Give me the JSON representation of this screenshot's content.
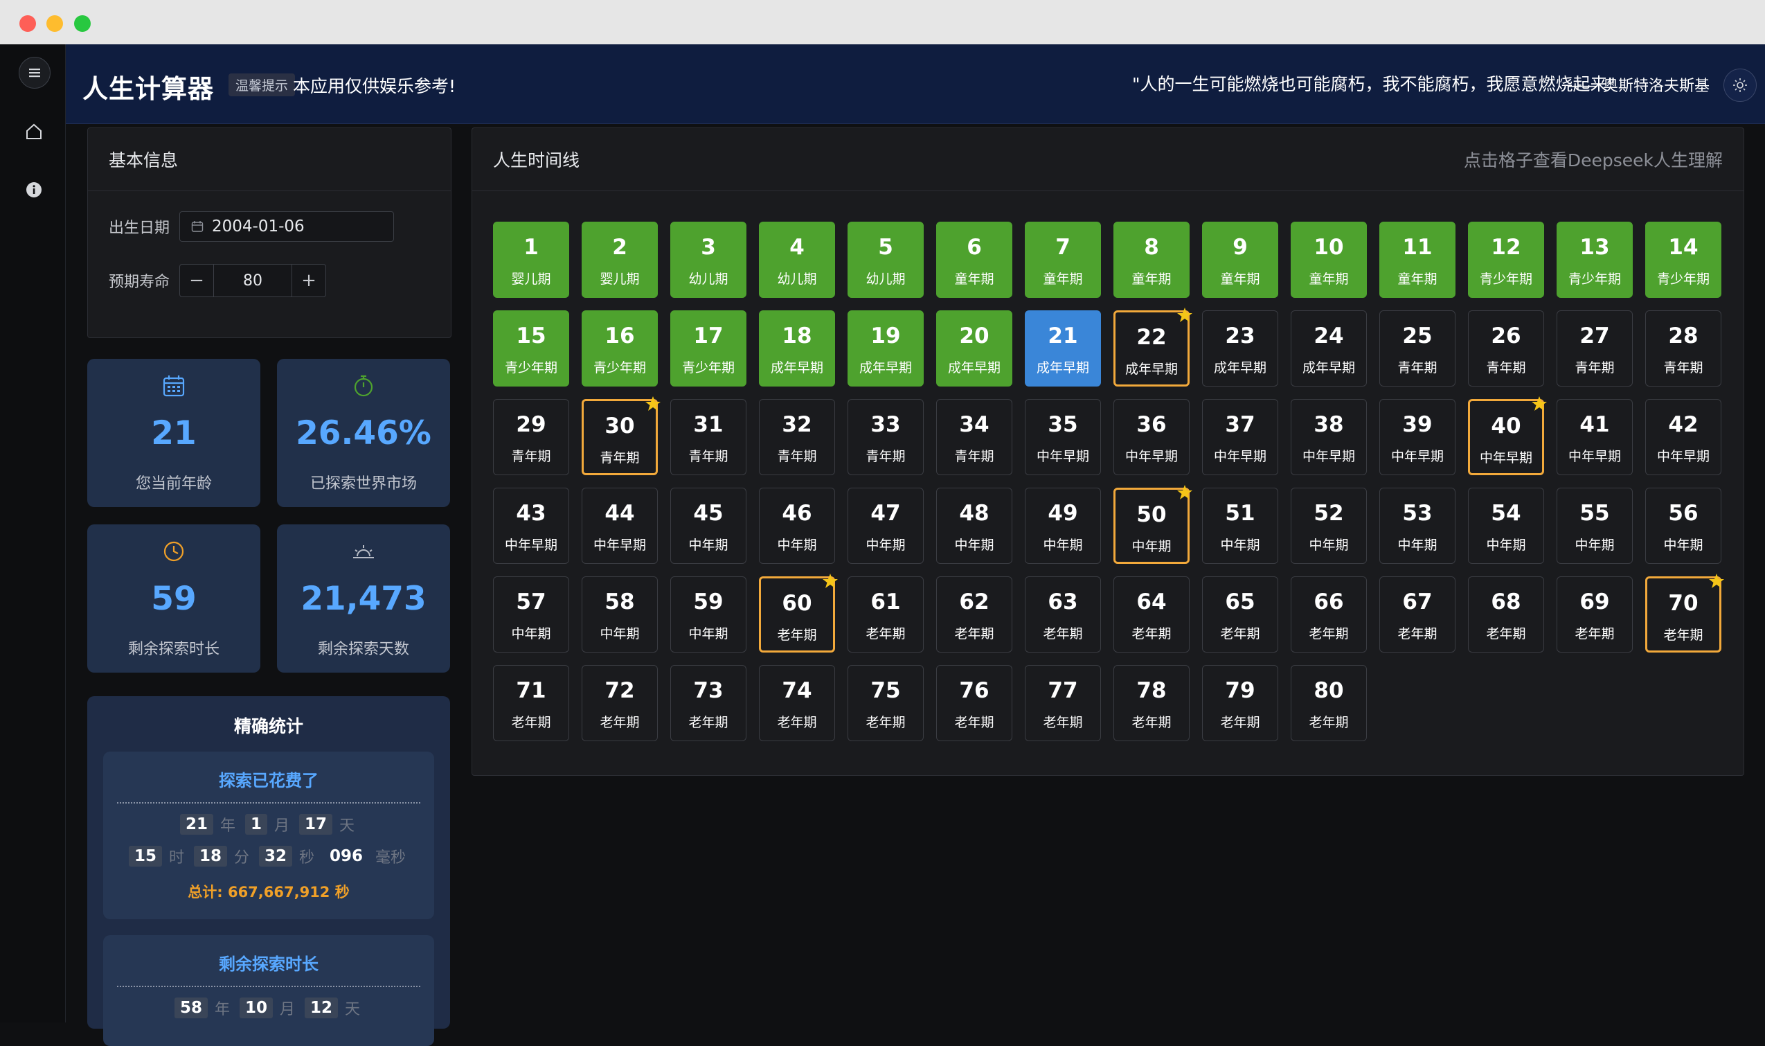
{
  "colors": {
    "past": "#4ea22e",
    "current": "#3a86d8",
    "milestone": "#f2a93b",
    "accent": "#58a8ff",
    "total": "#f0a028"
  },
  "header": {
    "title": "人生计算器",
    "tip_badge": "温馨提示",
    "tip_text": "本应用仅供娱乐参考!",
    "quote": "\"人的一生可能燃烧也可能腐朽，我不能腐朽，我愿意燃烧起来\"",
    "quote_author": "—— 奥斯特洛夫斯基"
  },
  "sidebar": {
    "items": [
      {
        "icon": "menu-icon"
      },
      {
        "icon": "home-icon"
      },
      {
        "icon": "info-icon"
      }
    ]
  },
  "basic_info": {
    "title": "基本信息",
    "birth_label": "出生日期",
    "birth_value": "2004-01-06",
    "life_label": "预期寿命",
    "life_value": "80",
    "minus": "−",
    "plus": "+"
  },
  "stats": [
    {
      "icon": "calendar-icon",
      "value": "21",
      "label": "您当前年龄"
    },
    {
      "icon": "stopwatch-icon",
      "value": "26.46%",
      "label": "已探索世界市场"
    },
    {
      "icon": "clock-icon",
      "value": "59",
      "label": "剩余探索时长"
    },
    {
      "icon": "sunrise-icon",
      "value": "21,473",
      "label": "剩余探索天数"
    }
  ],
  "precise": {
    "title": "精确统计",
    "spent": {
      "title": "探索已花费了",
      "years": "21",
      "months": "1",
      "days": "17",
      "hours": "15",
      "minutes": "18",
      "seconds": "32",
      "ms": "096",
      "total": "总计: 667,667,912 秒"
    },
    "remaining": {
      "title": "剩余探索时长",
      "years": "58",
      "months": "10",
      "days": "12"
    },
    "units": {
      "year": "年",
      "month": "月",
      "day": "天",
      "hour": "时",
      "minute": "分",
      "second": "秒",
      "ms": "毫秒"
    }
  },
  "timeline": {
    "title": "人生时间线",
    "hint": "点击格子查看Deepseek人生理解",
    "current_age": 21,
    "milestones": [
      22,
      30,
      40,
      50,
      60,
      70
    ],
    "years": [
      {
        "n": "1",
        "stage": "婴儿期"
      },
      {
        "n": "2",
        "stage": "婴儿期"
      },
      {
        "n": "3",
        "stage": "幼儿期"
      },
      {
        "n": "4",
        "stage": "幼儿期"
      },
      {
        "n": "5",
        "stage": "幼儿期"
      },
      {
        "n": "6",
        "stage": "童年期"
      },
      {
        "n": "7",
        "stage": "童年期"
      },
      {
        "n": "8",
        "stage": "童年期"
      },
      {
        "n": "9",
        "stage": "童年期"
      },
      {
        "n": "10",
        "stage": "童年期"
      },
      {
        "n": "11",
        "stage": "童年期"
      },
      {
        "n": "12",
        "stage": "青少年期"
      },
      {
        "n": "13",
        "stage": "青少年期"
      },
      {
        "n": "14",
        "stage": "青少年期"
      },
      {
        "n": "15",
        "stage": "青少年期"
      },
      {
        "n": "16",
        "stage": "青少年期"
      },
      {
        "n": "17",
        "stage": "青少年期"
      },
      {
        "n": "18",
        "stage": "成年早期"
      },
      {
        "n": "19",
        "stage": "成年早期"
      },
      {
        "n": "20",
        "stage": "成年早期"
      },
      {
        "n": "21",
        "stage": "成年早期"
      },
      {
        "n": "22",
        "stage": "成年早期"
      },
      {
        "n": "23",
        "stage": "成年早期"
      },
      {
        "n": "24",
        "stage": "成年早期"
      },
      {
        "n": "25",
        "stage": "青年期"
      },
      {
        "n": "26",
        "stage": "青年期"
      },
      {
        "n": "27",
        "stage": "青年期"
      },
      {
        "n": "28",
        "stage": "青年期"
      },
      {
        "n": "29",
        "stage": "青年期"
      },
      {
        "n": "30",
        "stage": "青年期"
      },
      {
        "n": "31",
        "stage": "青年期"
      },
      {
        "n": "32",
        "stage": "青年期"
      },
      {
        "n": "33",
        "stage": "青年期"
      },
      {
        "n": "34",
        "stage": "青年期"
      },
      {
        "n": "35",
        "stage": "中年早期"
      },
      {
        "n": "36",
        "stage": "中年早期"
      },
      {
        "n": "37",
        "stage": "中年早期"
      },
      {
        "n": "38",
        "stage": "中年早期"
      },
      {
        "n": "39",
        "stage": "中年早期"
      },
      {
        "n": "40",
        "stage": "中年早期"
      },
      {
        "n": "41",
        "stage": "中年早期"
      },
      {
        "n": "42",
        "stage": "中年早期"
      },
      {
        "n": "43",
        "stage": "中年早期"
      },
      {
        "n": "44",
        "stage": "中年早期"
      },
      {
        "n": "45",
        "stage": "中年期"
      },
      {
        "n": "46",
        "stage": "中年期"
      },
      {
        "n": "47",
        "stage": "中年期"
      },
      {
        "n": "48",
        "stage": "中年期"
      },
      {
        "n": "49",
        "stage": "中年期"
      },
      {
        "n": "50",
        "stage": "中年期"
      },
      {
        "n": "51",
        "stage": "中年期"
      },
      {
        "n": "52",
        "stage": "中年期"
      },
      {
        "n": "53",
        "stage": "中年期"
      },
      {
        "n": "54",
        "stage": "中年期"
      },
      {
        "n": "55",
        "stage": "中年期"
      },
      {
        "n": "56",
        "stage": "中年期"
      },
      {
        "n": "57",
        "stage": "中年期"
      },
      {
        "n": "58",
        "stage": "中年期"
      },
      {
        "n": "59",
        "stage": "中年期"
      },
      {
        "n": "60",
        "stage": "老年期"
      },
      {
        "n": "61",
        "stage": "老年期"
      },
      {
        "n": "62",
        "stage": "老年期"
      },
      {
        "n": "63",
        "stage": "老年期"
      },
      {
        "n": "64",
        "stage": "老年期"
      },
      {
        "n": "65",
        "stage": "老年期"
      },
      {
        "n": "66",
        "stage": "老年期"
      },
      {
        "n": "67",
        "stage": "老年期"
      },
      {
        "n": "68",
        "stage": "老年期"
      },
      {
        "n": "69",
        "stage": "老年期"
      },
      {
        "n": "70",
        "stage": "老年期"
      },
      {
        "n": "71",
        "stage": "老年期"
      },
      {
        "n": "72",
        "stage": "老年期"
      },
      {
        "n": "73",
        "stage": "老年期"
      },
      {
        "n": "74",
        "stage": "老年期"
      },
      {
        "n": "75",
        "stage": "老年期"
      },
      {
        "n": "76",
        "stage": "老年期"
      },
      {
        "n": "77",
        "stage": "老年期"
      },
      {
        "n": "78",
        "stage": "老年期"
      },
      {
        "n": "79",
        "stage": "老年期"
      },
      {
        "n": "80",
        "stage": "老年期"
      }
    ]
  }
}
